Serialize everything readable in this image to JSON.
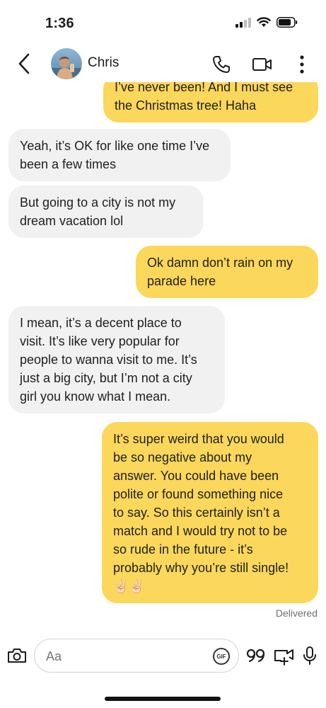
{
  "status_bar": {
    "time": "1:36"
  },
  "header": {
    "contact_name": "Chris"
  },
  "messages": [
    {
      "direction": "sent",
      "lines": [
        "I’ve never been! And I must see",
        "the Christmas tree! Haha"
      ]
    },
    {
      "direction": "received",
      "lines": [
        "Yeah, it’s OK for like one time I’ve",
        "been a few times"
      ]
    },
    {
      "direction": "received",
      "lines": [
        "But going to a city is not my",
        "dream vacation lol"
      ]
    },
    {
      "direction": "sent",
      "lines": [
        "Ok damn don’t rain on my",
        "parade here"
      ]
    },
    {
      "direction": "received",
      "lines": [
        "I mean, it’s a decent place to",
        "visit. It’s like very popular for",
        "people to wanna visit to me. It’s",
        "just a big city, but I’m not a city",
        "girl you know what I mean."
      ]
    },
    {
      "direction": "sent",
      "lines": [
        "It’s super weird that you would",
        "be so negative about my",
        "answer. You could have been",
        "polite or found something nice",
        "to say. So this certainly isn’t a",
        "match and I would try not to be",
        "so rude in the future - it’s",
        "probably why you’re still single!",
        "✌🏻✌🏻"
      ]
    }
  ],
  "delivered_label": "Delivered",
  "composer": {
    "placeholder": "Aa",
    "gif_label": "GIF"
  },
  "colors": {
    "sent_bubble": "#fbd75b",
    "received_bubble": "#f1f1f2"
  }
}
